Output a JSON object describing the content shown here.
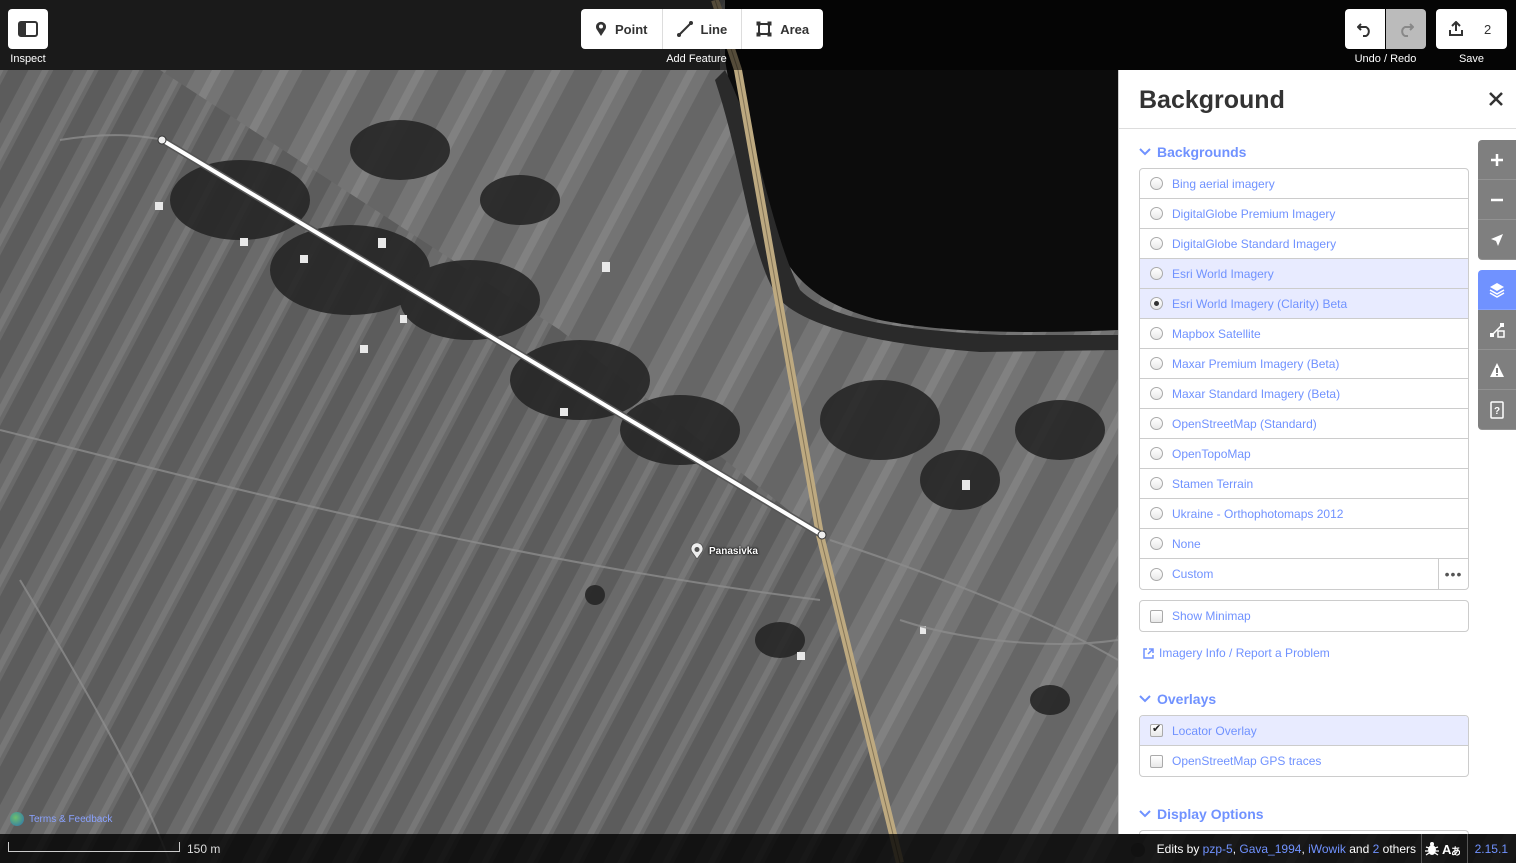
{
  "toolbar": {
    "inspect_label": "Inspect",
    "point_label": "Point",
    "line_label": "Line",
    "area_label": "Area",
    "add_feature_label": "Add Feature",
    "undo_redo_label": "Undo / Redo",
    "save_label": "Save",
    "save_count": "2"
  },
  "panel": {
    "title": "Background",
    "backgrounds_heading": "Backgrounds",
    "backgrounds": [
      {
        "label": "Bing aerial imagery",
        "selected": false
      },
      {
        "label": "DigitalGlobe Premium Imagery",
        "selected": false
      },
      {
        "label": "DigitalGlobe Standard Imagery",
        "selected": false
      },
      {
        "label": "Esri World Imagery",
        "selected": false
      },
      {
        "label": "Esri World Imagery (Clarity) Beta",
        "selected": true
      },
      {
        "label": "Mapbox Satellite",
        "selected": false
      },
      {
        "label": "Maxar Premium Imagery (Beta)",
        "selected": false
      },
      {
        "label": "Maxar Standard Imagery (Beta)",
        "selected": false
      },
      {
        "label": "OpenStreetMap (Standard)",
        "selected": false
      },
      {
        "label": "OpenTopoMap",
        "selected": false
      },
      {
        "label": "Stamen Terrain",
        "selected": false
      },
      {
        "label": "Ukraine - Orthophotomaps 2012",
        "selected": false
      },
      {
        "label": "None",
        "selected": false
      },
      {
        "label": "Custom",
        "selected": false
      }
    ],
    "custom_more": "•••",
    "show_minimap_label": "Show Minimap",
    "imagery_info_label": "Imagery Info / Report a Problem",
    "overlays_heading": "Overlays",
    "overlays": [
      {
        "label": "Locator Overlay",
        "checked": true
      },
      {
        "label": "OpenStreetMap GPS traces",
        "checked": false
      }
    ],
    "display_options_heading": "Display Options"
  },
  "map": {
    "place_label": "Panasivka",
    "terms_label": "Terms & Feedback"
  },
  "footer": {
    "scale_label": "150 m",
    "edits_prefix": "Edits by",
    "editors": [
      "pzp-5",
      "Gava_1994",
      "iWowik"
    ],
    "and_word": "and",
    "others_count": "2",
    "others_word": "others",
    "version": "2.15.1"
  },
  "colors": {
    "accent": "#7092ff",
    "highlight_row": "#e8ebff",
    "road_tan": "#c8b48a"
  }
}
